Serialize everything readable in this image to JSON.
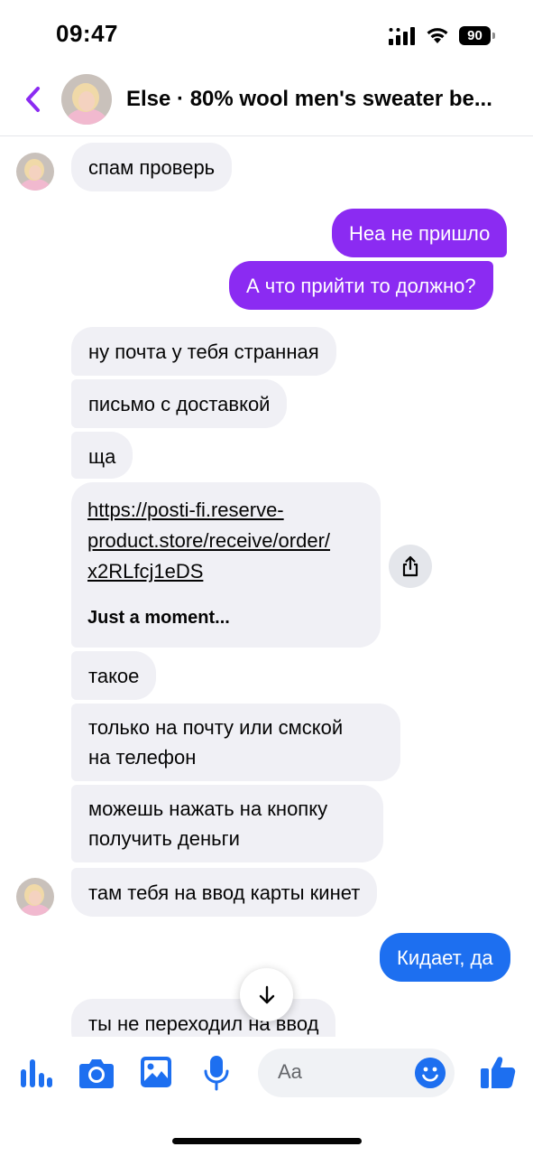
{
  "status_bar": {
    "time": "09:47",
    "battery": "90"
  },
  "header": {
    "title": "Else · 80% wool men's sweater be..."
  },
  "messages": [
    {
      "text": "спам проверь"
    },
    {
      "text": "Неа не пришло"
    },
    {
      "text": "А что прийти то должно?"
    },
    {
      "text": "ну почта у тебя странная"
    },
    {
      "text": "письмо с доставкой"
    },
    {
      "text": "ща"
    },
    {
      "url_lines": [
        "https://posti-fi.reserve-",
        "product.store/receive/order/",
        "x2RLfcj1eDS"
      ],
      "title": "Just a moment..."
    },
    {
      "text": "такое"
    },
    {
      "lines": [
        "только на почту или смской",
        "на телефон"
      ]
    },
    {
      "lines": [
        "можешь нажать на кнопку",
        "получить деньги"
      ]
    },
    {
      "text": "там тебя на ввод карты кинет"
    },
    {
      "text": "Кидает, да"
    },
    {
      "text": "ты не переходил на ввод"
    }
  ],
  "composer": {
    "placeholder": "Aa",
    "icons": [
      "audio-waveform-icon",
      "camera-icon",
      "image-icon",
      "microphone-icon",
      "emoji-icon",
      "thumbs-up-icon"
    ]
  },
  "colors": {
    "accent": "#1d6ff0",
    "purple": "#8b2bf2",
    "back": "#8b2bf2"
  }
}
